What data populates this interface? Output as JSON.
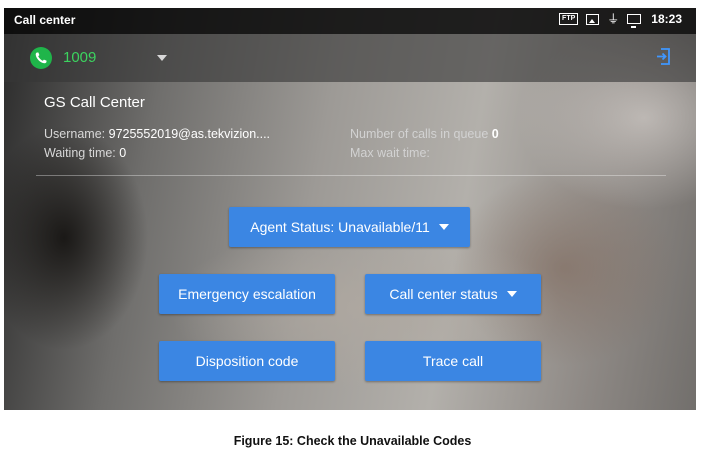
{
  "status_bar": {
    "app_title": "Call center",
    "icons": [
      "ftp-icon",
      "image-icon",
      "poe-icon",
      "monitor-icon"
    ],
    "ftp_label": "FTP",
    "time": "18:23"
  },
  "account": {
    "number": "1009",
    "icons": [
      "phone-icon",
      "chevron-down-icon",
      "logout-icon"
    ]
  },
  "call_center": {
    "title": "GS Call Center",
    "username_label": "Username:",
    "username_value": "9725552019@as.tekvizion....",
    "waiting_label": "Waiting time:",
    "waiting_value": "0",
    "queue_label": "Number of calls in queue",
    "queue_value": "0",
    "max_wait_label": "Max wait time:",
    "max_wait_value": ""
  },
  "buttons": {
    "agent_status": "Agent Status: Unavailable/11",
    "emergency": "Emergency escalation",
    "cc_status": "Call center status",
    "disposition": "Disposition code",
    "trace": "Trace call"
  },
  "caption": "Figure 15: Check the Unavailable Codes",
  "colors": {
    "accent_button": "#3b86e3",
    "phone_green": "#1fb54a",
    "account_text": "#3cd35f",
    "logout_icon": "#3f97ff"
  }
}
